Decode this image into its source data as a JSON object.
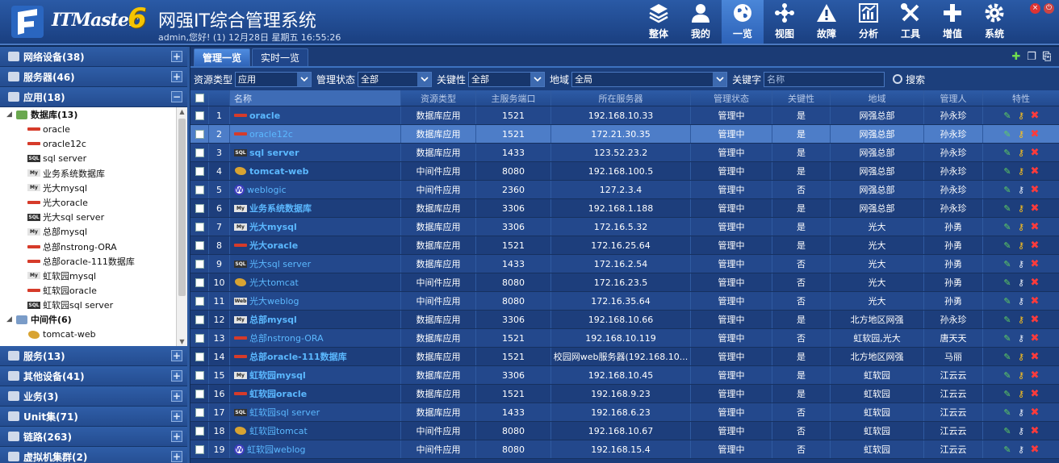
{
  "header": {
    "logo_text": "ITMaster",
    "logo_version": "6",
    "app_title": "网强IT综合管理系统",
    "user_line": "admin,您好! (1) 12月28日 星期五 16:55:26",
    "nav": [
      {
        "label": "整体",
        "icon": "layers-icon",
        "active": false
      },
      {
        "label": "我的",
        "icon": "user-icon",
        "active": false
      },
      {
        "label": "一览",
        "icon": "globe-icon",
        "active": true
      },
      {
        "label": "视图",
        "icon": "topology-icon",
        "active": false
      },
      {
        "label": "故障",
        "icon": "warning-icon",
        "active": false
      },
      {
        "label": "分析",
        "icon": "chart-icon",
        "active": false
      },
      {
        "label": "工具",
        "icon": "tools-icon",
        "active": false
      },
      {
        "label": "增值",
        "icon": "plus-icon",
        "active": false
      },
      {
        "label": "系统",
        "icon": "gear-icon",
        "active": false
      }
    ]
  },
  "sidebar": {
    "top_categories": [
      {
        "label": "网络设备(38)",
        "pm": "+"
      },
      {
        "label": "服务器(46)",
        "pm": "+"
      },
      {
        "label": "应用(18)",
        "pm": "−"
      }
    ],
    "tree": {
      "group_db": "数据库(13)",
      "db_items": [
        {
          "label": "oracle",
          "icon": "oracle"
        },
        {
          "label": "oracle12c",
          "icon": "oracle"
        },
        {
          "label": "sql server",
          "icon": "sql"
        },
        {
          "label": "业务系统数据库",
          "icon": "mysql"
        },
        {
          "label": "光大mysql",
          "icon": "mysql"
        },
        {
          "label": "光大oracle",
          "icon": "oracle"
        },
        {
          "label": "光大sql server",
          "icon": "sql"
        },
        {
          "label": "总部mysql",
          "icon": "mysql"
        },
        {
          "label": "总部nstrong-ORA",
          "icon": "oracle"
        },
        {
          "label": "总部oracle-111数据库",
          "icon": "oracle"
        },
        {
          "label": "虹软园mysql",
          "icon": "mysql"
        },
        {
          "label": "虹软园oracle",
          "icon": "oracle"
        },
        {
          "label": "虹软园sql server",
          "icon": "sql"
        }
      ],
      "group_mw": "中间件(6)",
      "mw_items": [
        {
          "label": "tomcat-web",
          "icon": "tomcat"
        }
      ]
    },
    "bottom_categories": [
      {
        "label": "服务(13)",
        "pm": "+"
      },
      {
        "label": "其他设备(41)",
        "pm": "+"
      },
      {
        "label": "业务(3)",
        "pm": "+"
      },
      {
        "label": "Unit集(71)",
        "pm": "+"
      },
      {
        "label": "链路(263)",
        "pm": "+"
      },
      {
        "label": "虚拟机集群(2)",
        "pm": "+"
      }
    ]
  },
  "tabs": [
    {
      "label": "管理一览",
      "active": true
    },
    {
      "label": "实时一览",
      "active": false
    }
  ],
  "filter": {
    "type_label": "资源类型",
    "type_value": "应用",
    "status_label": "管理状态",
    "status_value": "全部",
    "key_label": "关键性",
    "key_value": "全部",
    "region_label": "地域",
    "region_value": "全局",
    "keyword_label": "关键字",
    "keyword_placeholder": "名称",
    "search_label": "搜索"
  },
  "grid": {
    "columns": [
      "名称",
      "资源类型",
      "主服务端口",
      "所在服务器",
      "管理状态",
      "关键性",
      "地域",
      "管理人",
      "特性"
    ],
    "rows": [
      {
        "n": "1",
        "name": "oracle",
        "icon": "oracle",
        "bold": true,
        "type": "数据库应用",
        "port": "1521",
        "server": "192.168.10.33",
        "status": "管理中",
        "key": "是",
        "region": "网强总部",
        "admin": "孙永珍"
      },
      {
        "n": "2",
        "name": "oracle12c",
        "icon": "oracle",
        "bold": false,
        "type": "数据库应用",
        "port": "1521",
        "server": "172.21.30.35",
        "status": "管理中",
        "key": "是",
        "region": "网强总部",
        "admin": "孙永珍"
      },
      {
        "n": "3",
        "name": "sql server",
        "icon": "sql",
        "bold": true,
        "type": "数据库应用",
        "port": "1433",
        "server": "123.52.23.2",
        "status": "管理中",
        "key": "是",
        "region": "网强总部",
        "admin": "孙永珍"
      },
      {
        "n": "4",
        "name": "tomcat-web",
        "icon": "tomcat",
        "bold": true,
        "type": "中间件应用",
        "port": "8080",
        "server": "192.168.100.5",
        "status": "管理中",
        "key": "是",
        "region": "网强总部",
        "admin": "孙永珍"
      },
      {
        "n": "5",
        "name": "weblogic",
        "icon": "weblogic",
        "bold": false,
        "type": "中间件应用",
        "port": "2360",
        "server": "127.2.3.4",
        "status": "管理中",
        "key": "否",
        "region": "网强总部",
        "admin": "孙永珍"
      },
      {
        "n": "6",
        "name": "业务系统数据库",
        "icon": "mysql",
        "bold": true,
        "type": "数据库应用",
        "port": "3306",
        "server": "192.168.1.188",
        "status": "管理中",
        "key": "是",
        "region": "网强总部",
        "admin": "孙永珍"
      },
      {
        "n": "7",
        "name": "光大mysql",
        "icon": "mysql",
        "bold": true,
        "type": "数据库应用",
        "port": "3306",
        "server": "172.16.5.32",
        "status": "管理中",
        "key": "是",
        "region": "光大",
        "admin": "孙勇"
      },
      {
        "n": "8",
        "name": "光大oracle",
        "icon": "oracle",
        "bold": true,
        "type": "数据库应用",
        "port": "1521",
        "server": "172.16.25.64",
        "status": "管理中",
        "key": "是",
        "region": "光大",
        "admin": "孙勇"
      },
      {
        "n": "9",
        "name": "光大sql server",
        "icon": "sql",
        "bold": false,
        "type": "数据库应用",
        "port": "1433",
        "server": "172.16.2.54",
        "status": "管理中",
        "key": "否",
        "region": "光大",
        "admin": "孙勇"
      },
      {
        "n": "10",
        "name": "光大tomcat",
        "icon": "tomcat",
        "bold": false,
        "type": "中间件应用",
        "port": "8080",
        "server": "172.16.23.5",
        "status": "管理中",
        "key": "否",
        "region": "光大",
        "admin": "孙勇"
      },
      {
        "n": "11",
        "name": "光大weblog",
        "icon": "web",
        "bold": false,
        "type": "中间件应用",
        "port": "8080",
        "server": "172.16.35.64",
        "status": "管理中",
        "key": "否",
        "region": "光大",
        "admin": "孙勇"
      },
      {
        "n": "12",
        "name": "总部mysql",
        "icon": "mysql",
        "bold": true,
        "type": "数据库应用",
        "port": "3306",
        "server": "192.168.10.66",
        "status": "管理中",
        "key": "是",
        "region": "北方地区网强",
        "admin": "孙永珍"
      },
      {
        "n": "13",
        "name": "总部nstrong-ORA",
        "icon": "oracle",
        "bold": false,
        "type": "数据库应用",
        "port": "1521",
        "server": "192.168.10.119",
        "status": "管理中",
        "key": "否",
        "region": "虹软园,光大",
        "admin": "唐天天"
      },
      {
        "n": "14",
        "name": "总部oracle-111数据库",
        "icon": "oracle",
        "bold": true,
        "type": "数据库应用",
        "port": "1521",
        "server": "校园网web服务器(192.168.10...",
        "status": "管理中",
        "key": "是",
        "region": "北方地区网强",
        "admin": "马丽"
      },
      {
        "n": "15",
        "name": "虹软园mysql",
        "icon": "mysql",
        "bold": true,
        "type": "数据库应用",
        "port": "3306",
        "server": "192.168.10.45",
        "status": "管理中",
        "key": "是",
        "region": "虹软园",
        "admin": "江云云"
      },
      {
        "n": "16",
        "name": "虹软园oracle",
        "icon": "oracle",
        "bold": true,
        "type": "数据库应用",
        "port": "1521",
        "server": "192.168.9.23",
        "status": "管理中",
        "key": "是",
        "region": "虹软园",
        "admin": "江云云"
      },
      {
        "n": "17",
        "name": "虹软园sql server",
        "icon": "sql",
        "bold": false,
        "type": "数据库应用",
        "port": "1433",
        "server": "192.168.6.23",
        "status": "管理中",
        "key": "否",
        "region": "虹软园",
        "admin": "江云云"
      },
      {
        "n": "18",
        "name": "虹软园tomcat",
        "icon": "tomcat",
        "bold": false,
        "type": "中间件应用",
        "port": "8080",
        "server": "192.168.10.67",
        "status": "管理中",
        "key": "否",
        "region": "虹软园",
        "admin": "江云云"
      },
      {
        "n": "19",
        "name": "虹软园weblog",
        "icon": "weblogic",
        "bold": false,
        "type": "中间件应用",
        "port": "8080",
        "server": "192.168.15.4",
        "status": "管理中",
        "key": "否",
        "region": "虹软园",
        "admin": "江云云"
      }
    ]
  }
}
